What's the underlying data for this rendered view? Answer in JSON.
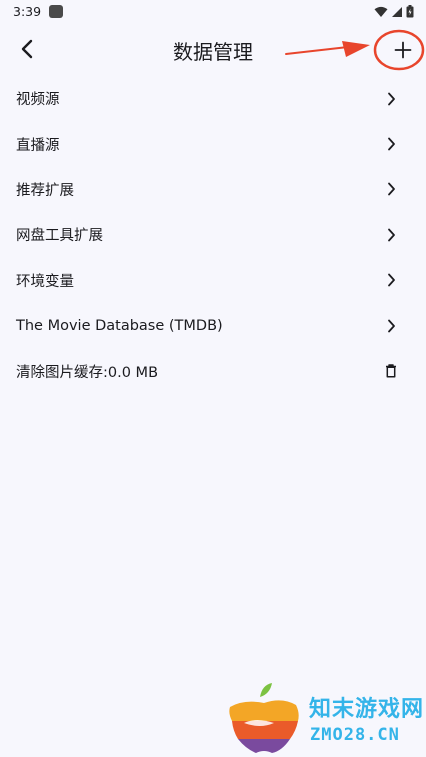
{
  "status_bar": {
    "time": "3:39"
  },
  "app_bar": {
    "title": "数据管理",
    "back_icon": "arrow-back-icon",
    "add_icon": "plus-icon"
  },
  "annotation": {
    "color": "#e8452c"
  },
  "list": {
    "items": [
      {
        "label": "视频源",
        "trailing_icon": "chevron-right-icon"
      },
      {
        "label": "直播源",
        "trailing_icon": "chevron-right-icon"
      },
      {
        "label": "推荐扩展",
        "trailing_icon": "chevron-right-icon"
      },
      {
        "label": "网盘工具扩展",
        "trailing_icon": "chevron-right-icon"
      },
      {
        "label": "环境变量",
        "trailing_icon": "chevron-right-icon"
      },
      {
        "label": "The Movie Database (TMDB)",
        "trailing_icon": "chevron-right-icon"
      },
      {
        "label": "清除图片缓存:0.0 MB",
        "trailing_icon": "trash-icon"
      }
    ]
  },
  "watermark": {
    "line1": "知末游戏网",
    "line2": "ZMO28.CN"
  },
  "colors": {
    "background": "#f7f7fd",
    "text": "#1b1b1f",
    "watermark": "#34b4e9"
  }
}
